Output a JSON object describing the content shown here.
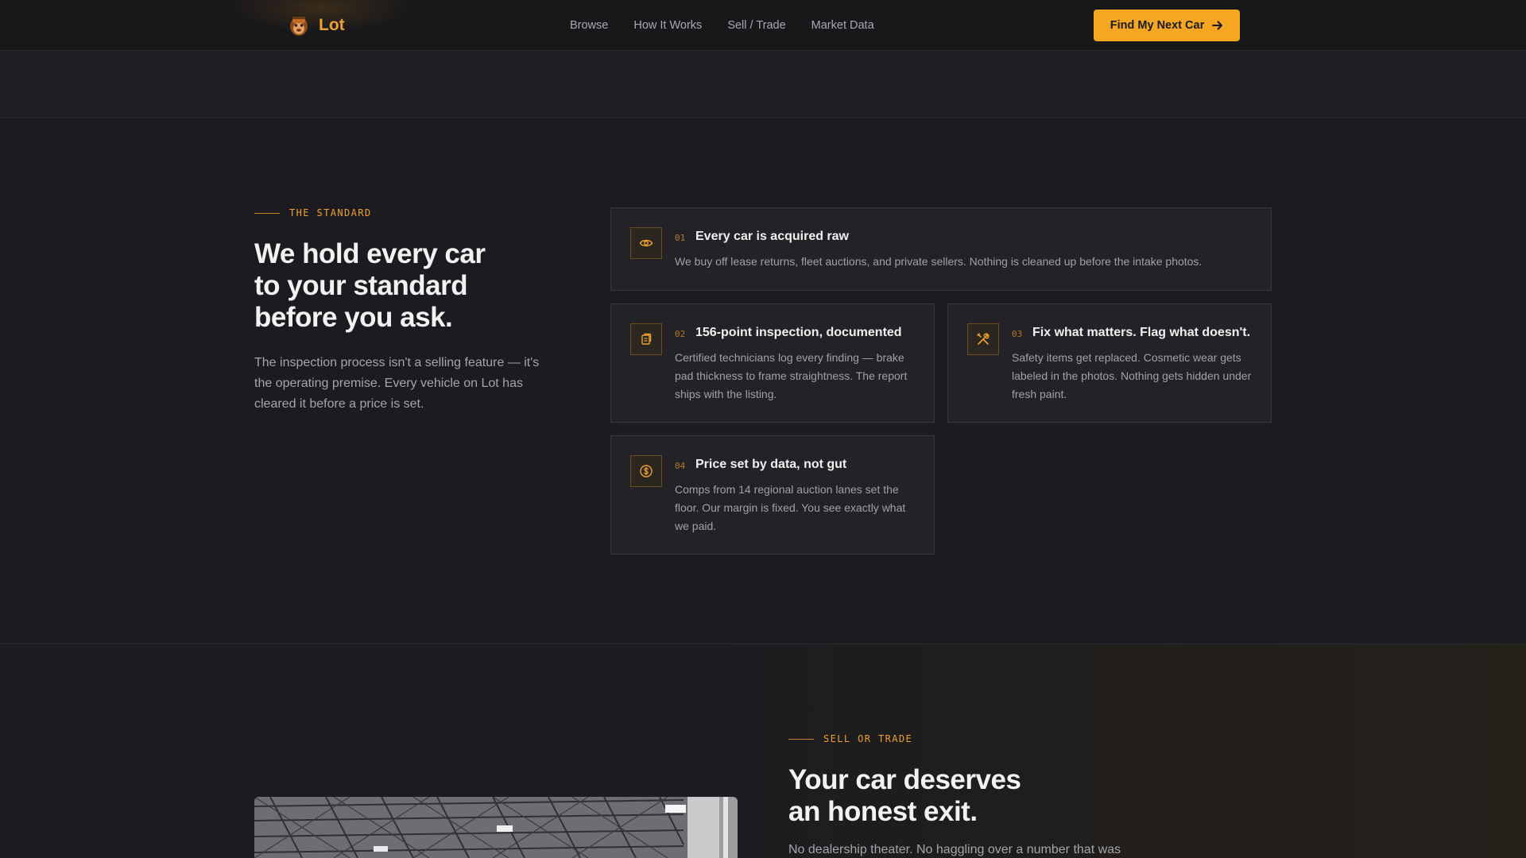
{
  "brand": {
    "name": "Lot"
  },
  "nav": {
    "links": [
      "Browse",
      "How It Works",
      "Sell / Trade",
      "Market Data"
    ],
    "cta_label": "Find My Next Car"
  },
  "standard": {
    "eyebrow": "THE STANDARD",
    "heading": [
      "We hold every car",
      "to your standard",
      "before you ask."
    ],
    "lead": [
      "The inspection process isn't a selling feature — it's",
      "the operating premise. Every vehicle on Lot has",
      "cleared it before a price is set."
    ],
    "cards": [
      {
        "num": "01",
        "icon": "eye-icon",
        "title": "Every car is acquired raw",
        "desc": "We buy off lease returns, fleet auctions, and private sellers. Nothing is cleaned up before the intake photos."
      },
      {
        "num": "02",
        "icon": "clipboard-icon",
        "title": "156-point inspection, documented",
        "desc": "Certified technicians log every finding — brake pad thickness to frame straightness. The report ships with the listing."
      },
      {
        "num": "03",
        "icon": "tools-icon",
        "title": "Fix what matters. Flag what doesn't.",
        "desc": "Safety items get replaced. Cosmetic wear gets labeled in the photos. Nothing gets hidden under fresh paint."
      },
      {
        "num": "04",
        "icon": "dollar-icon",
        "title": "Price set by data, not gut",
        "desc": "Comps from 14 regional auction lanes set the floor. Our margin is fixed. You see exactly what we paid."
      }
    ]
  },
  "sell": {
    "eyebrow": "SELL OR TRADE",
    "heading": [
      "Your car deserves",
      "an honest exit."
    ],
    "sub": "No dealership theater. No haggling over a number that was"
  },
  "colors": {
    "accent": "#f5a623",
    "bg": "#1c1c20",
    "card": "#232327"
  }
}
